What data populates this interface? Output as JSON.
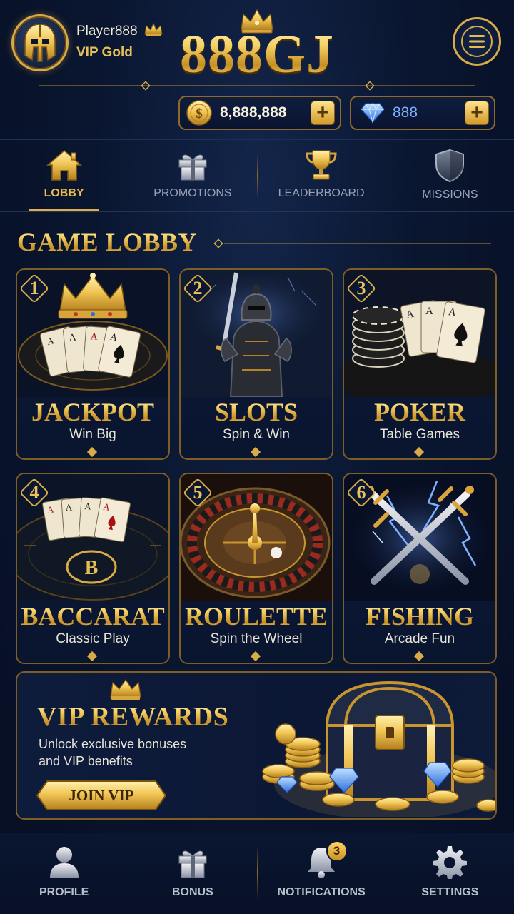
{
  "header": {
    "player_name": "Player888",
    "vip_level": "VIP Gold",
    "logo": "888GJ",
    "coins": "8,888,888",
    "gems": "888",
    "menu_icon": "hamburger-menu-icon",
    "avatar_icon": "spartan-helmet-icon"
  },
  "nav": {
    "tabs": [
      {
        "label": "LOBBY",
        "icon": "home-icon",
        "active": true
      },
      {
        "label": "PROMOTIONS",
        "icon": "gift-icon",
        "active": false
      },
      {
        "label": "LEADERBOARD",
        "icon": "trophy-icon",
        "active": false
      },
      {
        "label": "MISSIONS",
        "icon": "shield-icon",
        "active": false
      }
    ]
  },
  "lobby": {
    "title": "GAME LOBBY",
    "games": [
      {
        "number": "1",
        "name": "JACKPOT",
        "subtitle": "Win Big"
      },
      {
        "number": "2",
        "name": "SLOTS",
        "subtitle": "Spin & Win"
      },
      {
        "number": "3",
        "name": "POKER",
        "subtitle": "Table Games"
      },
      {
        "number": "4",
        "name": "BACCARAT",
        "subtitle": "Classic Play"
      },
      {
        "number": "5",
        "name": "ROULETTE",
        "subtitle": "Spin the Wheel"
      },
      {
        "number": "6",
        "name": "FISHING",
        "subtitle": "Arcade Fun"
      }
    ]
  },
  "vip": {
    "title": "VIP REWARDS",
    "desc_line1": "Unlock exclusive bonuses",
    "desc_line2": "and VIP benefits",
    "button": "JOIN VIP",
    "baccarat_letter": "B"
  },
  "bottom_nav": {
    "tabs": [
      {
        "label": "PROFILE",
        "icon": "person-icon"
      },
      {
        "label": "BONUS",
        "icon": "gift-icon"
      },
      {
        "label": "NOTIFICATIONS",
        "icon": "bell-icon",
        "badge": "3"
      },
      {
        "label": "SETTINGS",
        "icon": "gear-icon"
      }
    ]
  },
  "colors": {
    "background": "#0a1630",
    "gold": "#e0ad46",
    "gem_blue": "#7eb2ff",
    "inactive_text": "#9aa3b8"
  }
}
